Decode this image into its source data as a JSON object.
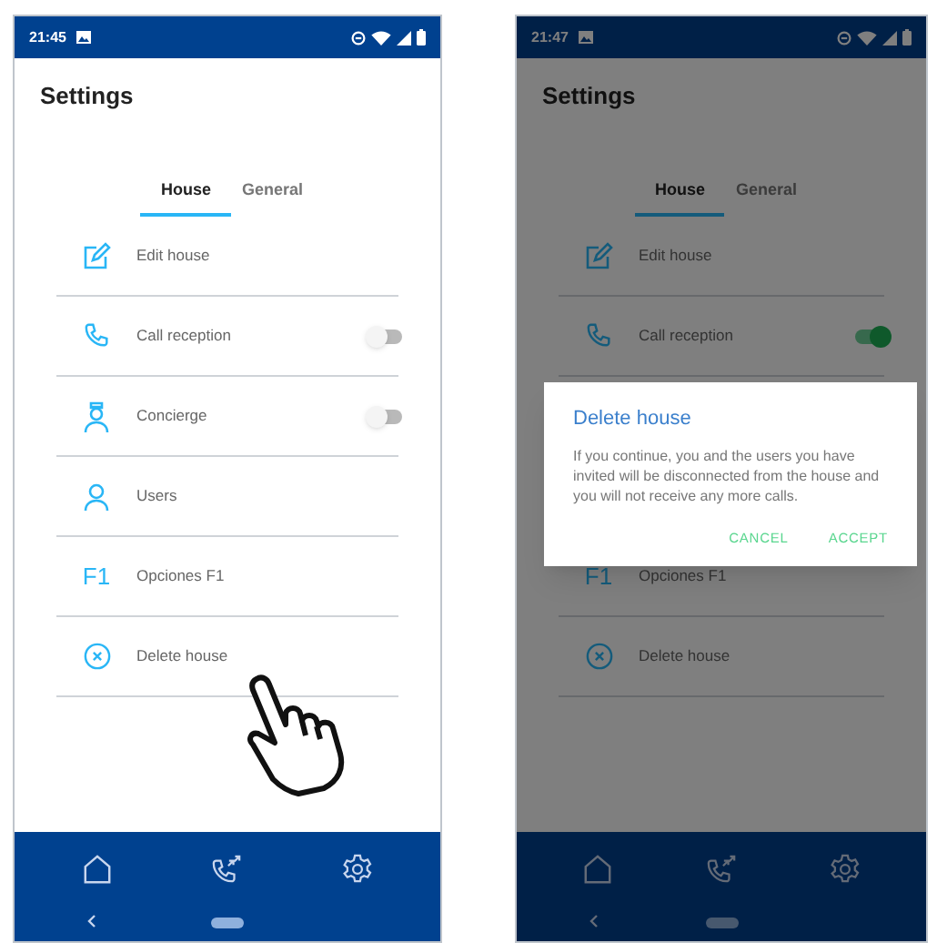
{
  "screens": [
    {
      "status_bar": {
        "time": "21:45"
      },
      "title": "Settings",
      "tabs": [
        {
          "label": "House",
          "selected": true
        },
        {
          "label": "General",
          "selected": false
        }
      ],
      "items": [
        {
          "kind": "edit",
          "label": "Edit house"
        },
        {
          "kind": "call",
          "label": "Call reception",
          "on": false
        },
        {
          "kind": "concierge",
          "label": "Concierge",
          "on": false
        },
        {
          "kind": "users",
          "label": "Users"
        },
        {
          "kind": "options",
          "icon_text": "F1",
          "label": "Opciones F1"
        },
        {
          "kind": "delete",
          "label": "Delete house"
        }
      ],
      "pointer_hint": true
    },
    {
      "status_bar": {
        "time": "21:47"
      },
      "title": "Settings",
      "tabs": [
        {
          "label": "House",
          "selected": true
        },
        {
          "label": "General",
          "selected": false
        }
      ],
      "items": [
        {
          "kind": "edit",
          "label": "Edit house"
        },
        {
          "kind": "call",
          "label": "Call reception",
          "on": true
        },
        {
          "kind": "options",
          "icon_text": "F1",
          "label": "Opciones F1"
        },
        {
          "kind": "delete",
          "label": "Delete house"
        }
      ],
      "dialog": {
        "title": "Delete house",
        "message": "If you continue, you and the users you have invited will be disconnected from the house and you will not receive any more calls.",
        "buttons": [
          "CANCEL",
          "ACCEPT"
        ]
      }
    }
  ]
}
